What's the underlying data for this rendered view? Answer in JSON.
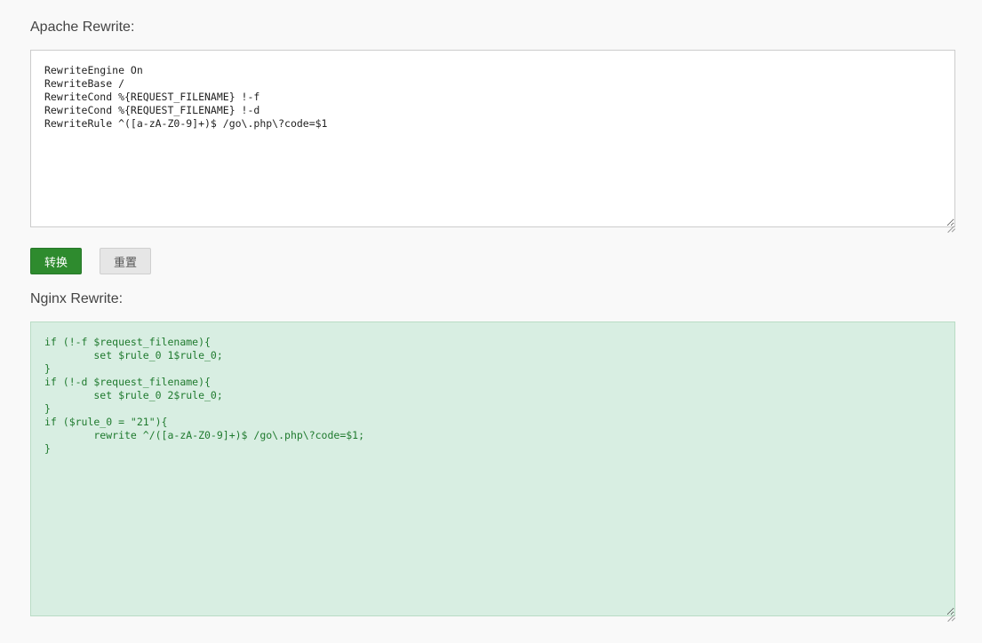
{
  "apache": {
    "label": "Apache Rewrite:",
    "content": "RewriteEngine On\nRewriteBase /\nRewriteCond %{REQUEST_FILENAME} !-f\nRewriteCond %{REQUEST_FILENAME} !-d\nRewriteRule ^([a-zA-Z0-9]+)$ /go\\.php\\?code=$1"
  },
  "buttons": {
    "convert_label": "转换",
    "reset_label": "重置"
  },
  "nginx": {
    "label": "Nginx Rewrite:",
    "content": "if (!-f $request_filename){\n        set $rule_0 1$rule_0;\n}\nif (!-d $request_filename){\n        set $rule_0 2$rule_0;\n}\nif ($rule_0 = \"21\"){\n        rewrite ^/([a-zA-Z0-9]+)$ /go\\.php\\?code=$1;\n}"
  },
  "colors": {
    "convert_button_bg": "#2e8b2e",
    "nginx_output_bg": "#d8eee2",
    "nginx_output_text": "#1f7a2e"
  }
}
